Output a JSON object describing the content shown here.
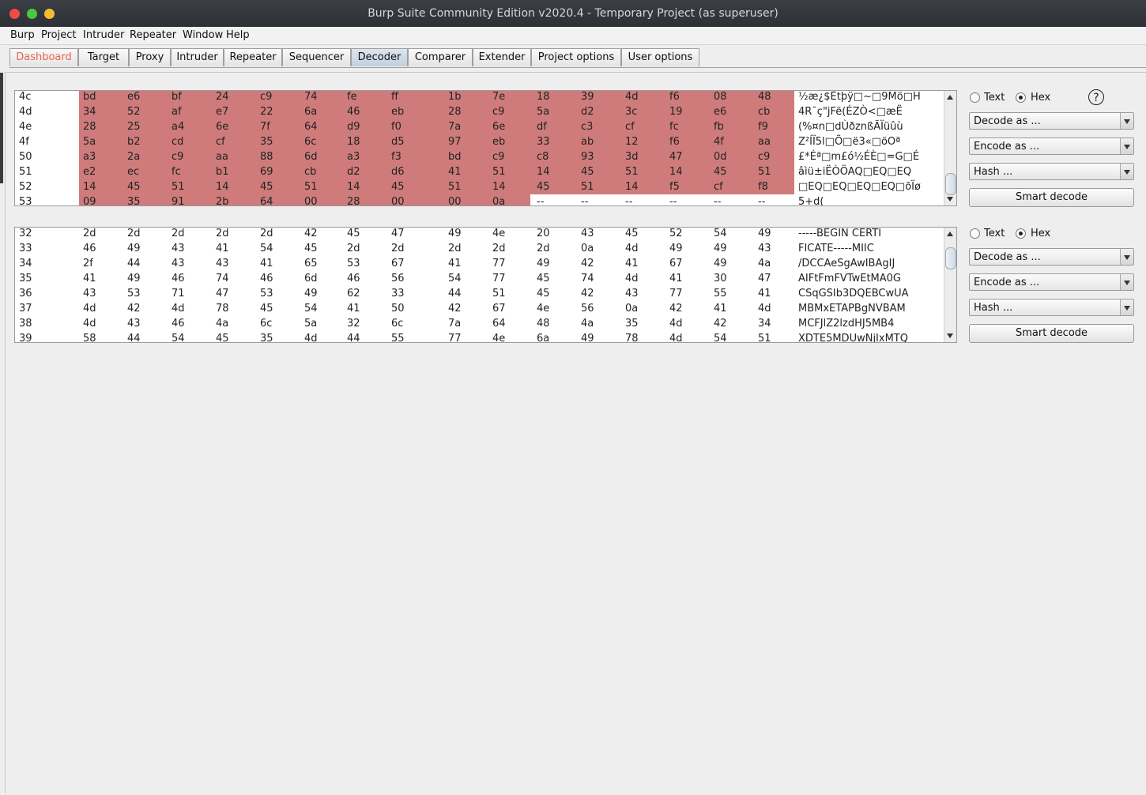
{
  "window": {
    "title": "Burp Suite Community Edition v2020.4 - Temporary Project (as superuser)"
  },
  "menu": [
    "Burp",
    "Project",
    "Intruder",
    "Repeater",
    "Window",
    "Help"
  ],
  "tabs": [
    {
      "label": "Dashboard"
    },
    {
      "label": "Target"
    },
    {
      "label": "Proxy"
    },
    {
      "label": "Intruder"
    },
    {
      "label": "Repeater"
    },
    {
      "label": "Sequencer"
    },
    {
      "label": "Decoder"
    },
    {
      "label": "Comparer"
    },
    {
      "label": "Extender"
    },
    {
      "label": "Project options"
    },
    {
      "label": "User options"
    }
  ],
  "active_tab": "Decoder",
  "colors": {
    "highlight": "#cf7b7b",
    "dashboard_tab": "#e8664d"
  },
  "panels": [
    {
      "rows": [
        {
          "addr": "4c",
          "bytes": [
            "bd",
            "e6",
            "bf",
            "24",
            "c9",
            "74",
            "fe",
            "ff",
            "1b",
            "7e",
            "18",
            "39",
            "4d",
            "f6",
            "08",
            "48"
          ],
          "ascii": "½æ¿$Étþÿ□~□9Mö□H"
        },
        {
          "addr": "4d",
          "bytes": [
            "34",
            "52",
            "af",
            "e7",
            "22",
            "6a",
            "46",
            "eb",
            "28",
            "c9",
            "5a",
            "d2",
            "3c",
            "19",
            "e6",
            "cb"
          ],
          "ascii": "4R¯ç\"jFë(ÉZÒ<□æË"
        },
        {
          "addr": "4e",
          "bytes": [
            "28",
            "25",
            "a4",
            "6e",
            "7f",
            "64",
            "d9",
            "f0",
            "7a",
            "6e",
            "df",
            "c3",
            "cf",
            "fc",
            "fb",
            "f9"
          ],
          "ascii": "(%¤n□dÙðznßÃÏüûù"
        },
        {
          "addr": "4f",
          "bytes": [
            "5a",
            "b2",
            "cd",
            "cf",
            "35",
            "6c",
            "18",
            "d5",
            "97",
            "eb",
            "33",
            "ab",
            "12",
            "f6",
            "4f",
            "aa"
          ],
          "ascii": "Z²ÍÏ5l□Õ□ë3«□öOª"
        },
        {
          "addr": "50",
          "bytes": [
            "a3",
            "2a",
            "c9",
            "aa",
            "88",
            "6d",
            "a3",
            "f3",
            "bd",
            "c9",
            "c8",
            "93",
            "3d",
            "47",
            "0d",
            "c9"
          ],
          "ascii": "£*Éª□m£ó½ÉÈ□=G□É"
        },
        {
          "addr": "51",
          "bytes": [
            "e2",
            "ec",
            "fc",
            "b1",
            "69",
            "cb",
            "d2",
            "d6",
            "41",
            "51",
            "14",
            "45",
            "51",
            "14",
            "45",
            "51"
          ],
          "ascii": "âìü±iËÒÖAQ□EQ□EQ"
        },
        {
          "addr": "52",
          "bytes": [
            "14",
            "45",
            "51",
            "14",
            "45",
            "51",
            "14",
            "45",
            "51",
            "14",
            "45",
            "51",
            "14",
            "f5",
            "cf",
            "f8"
          ],
          "ascii": "□EQ□EQ□EQ□EQ□õÏø"
        },
        {
          "addr": "53",
          "bytes": [
            "09",
            "35",
            "91",
            "2b",
            "64",
            "00",
            "28",
            "00",
            "00",
            "0a",
            "--",
            "--",
            "--",
            "--",
            "--",
            "--"
          ],
          "ascii": "5+d("
        }
      ],
      "controls": {
        "text_label": "Text",
        "hex_label": "Hex",
        "selected": "Hex",
        "help": "?",
        "decode": "Decode as ...",
        "encode": "Encode as ...",
        "hash": "Hash ...",
        "smart": "Smart decode"
      }
    },
    {
      "rows": [
        {
          "addr": "32",
          "bytes": [
            "2d",
            "2d",
            "2d",
            "2d",
            "2d",
            "42",
            "45",
            "47",
            "49",
            "4e",
            "20",
            "43",
            "45",
            "52",
            "54",
            "49"
          ],
          "ascii": "-----BEGIN CERTI"
        },
        {
          "addr": "33",
          "bytes": [
            "46",
            "49",
            "43",
            "41",
            "54",
            "45",
            "2d",
            "2d",
            "2d",
            "2d",
            "2d",
            "0a",
            "4d",
            "49",
            "49",
            "43"
          ],
          "ascii": "FICATE-----MIIC"
        },
        {
          "addr": "34",
          "bytes": [
            "2f",
            "44",
            "43",
            "43",
            "41",
            "65",
            "53",
            "67",
            "41",
            "77",
            "49",
            "42",
            "41",
            "67",
            "49",
            "4a"
          ],
          "ascii": "/DCCAeSgAwIBAgIJ"
        },
        {
          "addr": "35",
          "bytes": [
            "41",
            "49",
            "46",
            "74",
            "46",
            "6d",
            "46",
            "56",
            "54",
            "77",
            "45",
            "74",
            "4d",
            "41",
            "30",
            "47"
          ],
          "ascii": "AIFtFmFVTwEtMA0G"
        },
        {
          "addr": "36",
          "bytes": [
            "43",
            "53",
            "71",
            "47",
            "53",
            "49",
            "62",
            "33",
            "44",
            "51",
            "45",
            "42",
            "43",
            "77",
            "55",
            "41"
          ],
          "ascii": "CSqGSIb3DQEBCwUA"
        },
        {
          "addr": "37",
          "bytes": [
            "4d",
            "42",
            "4d",
            "78",
            "45",
            "54",
            "41",
            "50",
            "42",
            "67",
            "4e",
            "56",
            "0a",
            "42",
            "41",
            "4d"
          ],
          "ascii": "MBMxETAPBgNVBAM"
        },
        {
          "addr": "38",
          "bytes": [
            "4d",
            "43",
            "46",
            "4a",
            "6c",
            "5a",
            "32",
            "6c",
            "7a",
            "64",
            "48",
            "4a",
            "35",
            "4d",
            "42",
            "34"
          ],
          "ascii": "MCFJlZ2lzdHJ5MB4"
        },
        {
          "addr": "39",
          "bytes": [
            "58",
            "44",
            "54",
            "45",
            "35",
            "4d",
            "44",
            "55",
            "77",
            "4e",
            "6a",
            "49",
            "78",
            "4d",
            "54",
            "51"
          ],
          "ascii": "XDTE5MDUwNjIxMTQ"
        }
      ],
      "controls": {
        "text_label": "Text",
        "hex_label": "Hex",
        "selected": "Hex",
        "decode": "Decode as ...",
        "encode": "Encode as ...",
        "hash": "Hash ...",
        "smart": "Smart decode"
      }
    }
  ]
}
